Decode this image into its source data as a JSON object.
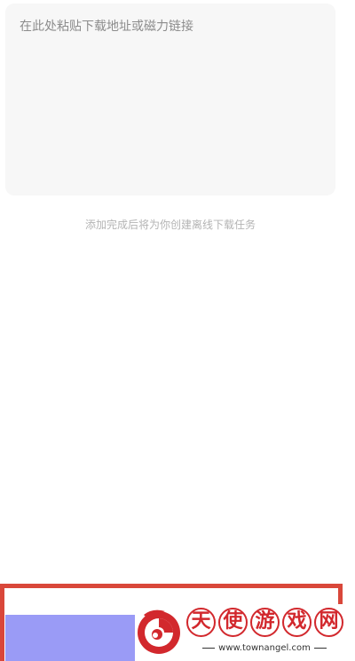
{
  "paste": {
    "placeholder": "在此处粘贴下载地址或磁力链接",
    "value": ""
  },
  "hint": {
    "text": "添加完成后将为你创建离线下载任务"
  },
  "colors": {
    "button": "#9a9bf6",
    "frame": "#d9473a",
    "watermark": "#d2282d"
  },
  "watermark": {
    "logo_icon": "angel-swirl-logo",
    "chars": [
      "天",
      "使",
      "游",
      "戏",
      "网"
    ],
    "url": "www.townangel.com"
  }
}
